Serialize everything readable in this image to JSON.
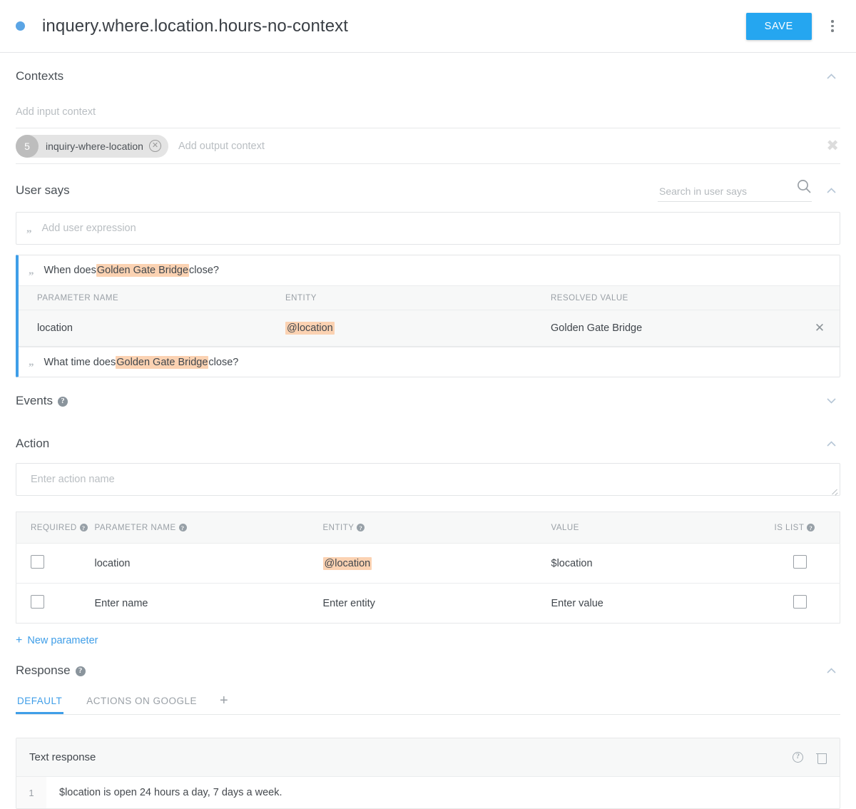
{
  "header": {
    "status_dot": "active-dot",
    "title": "inquery.where.location.hours-no-context",
    "save_label": "SAVE",
    "menu_icon": "more-vert-icon"
  },
  "contexts": {
    "title": "Contexts",
    "input_placeholder": "Add input context",
    "output_placeholder": "Add output context",
    "output_chip": {
      "lifespan": "5",
      "name": "inquiry-where-location",
      "remove_icon": "close-circle-icon"
    },
    "clear_icon": "close-icon",
    "collapse_icon": "chevron-up-icon"
  },
  "user_says": {
    "title": "User says",
    "search_placeholder": "Search in user says",
    "search_value": "",
    "search_icon": "search-icon",
    "collapse_icon": "chevron-up-icon",
    "add_expression_placeholder": "Add user expression",
    "quote_icon": "quote-icon",
    "expressions": [
      {
        "prefix": "When does ",
        "highlight": "Golden Gate Bridge",
        "suffix": " close?"
      },
      {
        "prefix": "What time does ",
        "highlight": "Golden Gate Bridge",
        "suffix": " close?"
      }
    ],
    "param_table": {
      "headers": [
        "PARAMETER NAME",
        "ENTITY",
        "RESOLVED VALUE"
      ],
      "rows": [
        {
          "parameter_name": "location",
          "entity": "@location",
          "resolved_value": "Golden Gate Bridge",
          "remove_icon": "close-icon"
        }
      ]
    }
  },
  "events": {
    "title": "Events",
    "help_icon": "help-icon",
    "expand_icon": "chevron-down-icon"
  },
  "action": {
    "title": "Action",
    "collapse_icon": "chevron-up-icon",
    "name_placeholder": "Enter action name",
    "name_value": "",
    "resize_icon": "resize-grip-icon",
    "headers": [
      {
        "label": "REQUIRED",
        "help": true
      },
      {
        "label": "PARAMETER NAME",
        "help": true
      },
      {
        "label": "ENTITY",
        "help": true
      },
      {
        "label": "VALUE",
        "help": false
      },
      {
        "label": "IS LIST",
        "help": true
      }
    ],
    "rows": [
      {
        "required_checked": false,
        "parameter_name": "location",
        "entity": "@location",
        "value": "$location",
        "is_list_checked": false,
        "is_placeholder": false
      },
      {
        "required_checked": false,
        "parameter_name": "Enter name",
        "entity": "Enter entity",
        "value": "Enter value",
        "is_list_checked": false,
        "is_placeholder": true
      }
    ],
    "new_parameter_label": "New parameter",
    "new_parameter_icon": "plus-icon"
  },
  "response": {
    "title": "Response",
    "help_icon": "help-icon",
    "collapse_icon": "chevron-up-icon",
    "tabs": [
      {
        "label": "DEFAULT",
        "active": true
      },
      {
        "label": "ACTIONS ON GOOGLE",
        "active": false
      }
    ],
    "add_tab_icon": "plus-icon",
    "text_response": {
      "title": "Text response",
      "help_icon": "help-circle-outline-icon",
      "delete_icon": "trash-icon",
      "rows": [
        {
          "number": "1",
          "text": "$location is open 24 hours a day, 7 days a week."
        }
      ]
    }
  },
  "colors": {
    "accent_blue": "#3f9ee8",
    "save_blue": "#25a6f0",
    "entity_highlight": "#fbd2b2",
    "muted_text": "#9aa0a6"
  }
}
